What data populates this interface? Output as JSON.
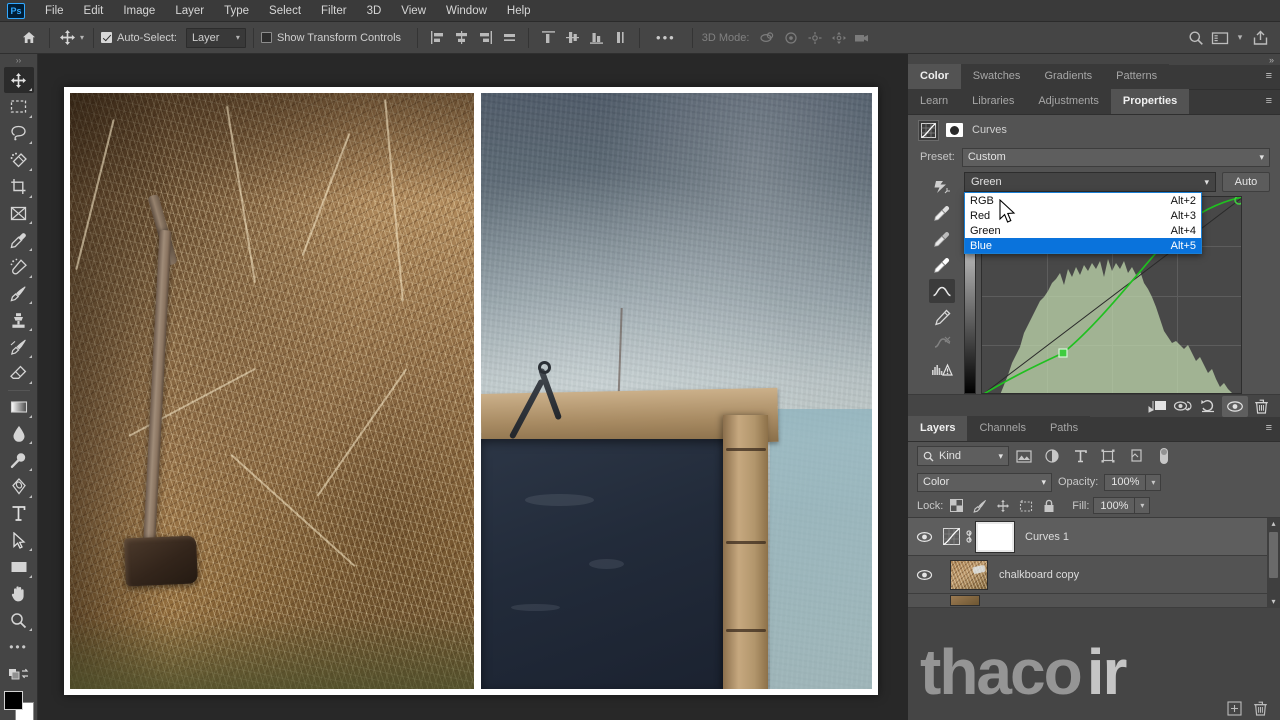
{
  "app": {
    "logo": "Ps",
    "menus": [
      "File",
      "Edit",
      "Image",
      "Layer",
      "Type",
      "Select",
      "Filter",
      "3D",
      "View",
      "Window",
      "Help"
    ]
  },
  "options_bar": {
    "home_icon": "home-icon",
    "tool_icon": "move-tool-icon",
    "auto_select_label": "Auto-Select:",
    "auto_select_checked": true,
    "auto_select_scope": "Layer",
    "show_transform_label": "Show Transform Controls",
    "show_transform_checked": false,
    "align_icons": [
      "align-left-edges-icon",
      "align-horizontal-centers-icon",
      "align-right-edges-icon",
      "distribute-horizontal-icon"
    ],
    "distribute_icons": [
      "align-top-edges-icon",
      "align-vertical-centers-icon",
      "align-bottom-edges-icon",
      "distribute-vertical-icon"
    ],
    "more_label": "•••",
    "three_d_label": "3D Mode:",
    "three_d_icons": [
      "orbit-3d-icon",
      "roll-3d-icon",
      "pan-3d-icon",
      "slide-3d-icon",
      "camera-3d-icon"
    ],
    "right_icons": [
      "search-icon",
      "workspace-icon",
      "chevron-down-icon",
      "share-icon"
    ]
  },
  "toolbar": {
    "tools": [
      {
        "name": "move-tool",
        "icon": "move-icon",
        "selected": true
      },
      {
        "name": "rectangular-marquee-tool",
        "icon": "marquee-icon",
        "selected": false
      },
      {
        "name": "lasso-tool",
        "icon": "lasso-icon",
        "selected": false
      },
      {
        "name": "quick-selection-tool",
        "icon": "quick-select-icon",
        "selected": false
      },
      {
        "name": "crop-tool",
        "icon": "crop-icon",
        "selected": false
      },
      {
        "name": "frame-tool",
        "icon": "frame-icon",
        "selected": false
      },
      {
        "name": "eyedropper-tool",
        "icon": "eyedropper-icon",
        "selected": false
      },
      {
        "name": "spot-healing-brush-tool",
        "icon": "healing-brush-icon",
        "selected": false
      },
      {
        "name": "brush-tool",
        "icon": "brush-icon",
        "selected": false
      },
      {
        "name": "clone-stamp-tool",
        "icon": "clone-stamp-icon",
        "selected": false
      },
      {
        "name": "history-brush-tool",
        "icon": "history-brush-icon",
        "selected": false
      },
      {
        "name": "eraser-tool",
        "icon": "eraser-icon",
        "selected": false
      },
      {
        "name": "gradient-tool",
        "icon": "gradient-icon",
        "selected": false
      },
      {
        "name": "blur-tool",
        "icon": "blur-drop-icon",
        "selected": false
      },
      {
        "name": "dodge-tool",
        "icon": "dodge-icon",
        "selected": false
      },
      {
        "name": "pen-tool",
        "icon": "pen-icon",
        "selected": false
      },
      {
        "name": "horizontal-type-tool",
        "icon": "type-icon",
        "selected": false
      },
      {
        "name": "path-selection-tool",
        "icon": "path-select-arrow-icon",
        "selected": false
      },
      {
        "name": "rectangle-tool",
        "icon": "rectangle-icon",
        "selected": false
      },
      {
        "name": "hand-tool",
        "icon": "hand-icon",
        "selected": false
      },
      {
        "name": "zoom-tool",
        "icon": "zoom-magnifier-icon",
        "selected": false
      },
      {
        "name": "edit-toolbar",
        "icon": "ellipsis-icon",
        "selected": false
      }
    ],
    "foreground_color": "#000000",
    "background_color": "#ffffff"
  },
  "canvas": {
    "left_photo_alt": "hay-bale-with-axe-photo",
    "right_photo_alt": "chalkboard-on-weathered-wall-photo"
  },
  "top_dock": {
    "tabs": [
      {
        "label": "Color",
        "active": true
      },
      {
        "label": "Swatches",
        "active": false
      },
      {
        "label": "Gradients",
        "active": false
      },
      {
        "label": "Patterns",
        "active": false
      }
    ],
    "menu_icon": "panel-menu-icon"
  },
  "properties_dock": {
    "tabs": [
      {
        "label": "Learn",
        "active": false
      },
      {
        "label": "Libraries",
        "active": false
      },
      {
        "label": "Adjustments",
        "active": false
      },
      {
        "label": "Properties",
        "active": true
      }
    ],
    "menu_icon": "panel-menu-icon"
  },
  "curves": {
    "title": "Curves",
    "adjustment_icon": "curves-adjustment-icon",
    "mask_icon": "layer-mask-icon",
    "preset_label": "Preset:",
    "preset_value": "Custom",
    "channel_value": "Green",
    "auto_label": "Auto",
    "channel_options": [
      {
        "label": "RGB",
        "shortcut": "Alt+2",
        "selected": false
      },
      {
        "label": "Red",
        "shortcut": "Alt+3",
        "selected": false
      },
      {
        "label": "Green",
        "shortcut": "Alt+4",
        "selected": false
      },
      {
        "label": "Blue",
        "shortcut": "Alt+5",
        "selected": true
      }
    ],
    "tools": [
      {
        "name": "on-image-adjustment-tool",
        "icon": "target-adjust-icon",
        "selected": false
      },
      {
        "name": "black-point-eyedropper",
        "icon": "eyedropper-black-icon",
        "selected": false
      },
      {
        "name": "gray-point-eyedropper",
        "icon": "eyedropper-gray-icon",
        "selected": false
      },
      {
        "name": "white-point-eyedropper",
        "icon": "eyedropper-white-icon",
        "selected": false
      },
      {
        "name": "curve-point-tool",
        "icon": "curve-point-icon",
        "selected": true
      },
      {
        "name": "pencil-draw-curve-tool",
        "icon": "pencil-icon",
        "selected": false
      },
      {
        "name": "smooth-curve-tool",
        "icon": "smooth-curve-icon",
        "selected": false
      },
      {
        "name": "histogram-options",
        "icon": "histogram-warning-icon",
        "selected": false
      }
    ],
    "bottom_icons": [
      {
        "name": "clip-to-layer-button",
        "icon": "clip-to-layer-icon",
        "highlighted": false
      },
      {
        "name": "toggle-previous-state-button",
        "icon": "eye-cycle-icon",
        "highlighted": false
      },
      {
        "name": "reset-adjustment-button",
        "icon": "reset-arrow-icon",
        "highlighted": false
      },
      {
        "name": "toggle-visibility-button",
        "icon": "eye-icon",
        "highlighted": true
      },
      {
        "name": "delete-adjustment-button",
        "icon": "trash-icon",
        "highlighted": false
      }
    ],
    "graph": {
      "curve_color": "#20c020",
      "histogram_color": "#c3ddb0",
      "control_points": [
        {
          "x": 0.0,
          "y": 0.0
        },
        {
          "x": 0.31,
          "y": 0.21
        },
        {
          "x": 0.73,
          "y": 0.86
        },
        {
          "x": 1.0,
          "y": 1.0
        }
      ],
      "grid_divisions": 4
    }
  },
  "layers_panel": {
    "tabs": [
      {
        "label": "Layers",
        "active": true
      },
      {
        "label": "Channels",
        "active": false
      },
      {
        "label": "Paths",
        "active": false
      }
    ],
    "menu_icon": "panel-menu-icon",
    "filter_label": "Kind",
    "filter_icon": "search-icon",
    "filter_type_icons": [
      "image-filter-icon",
      "adjustment-filter-icon",
      "type-filter-icon",
      "shape-filter-icon",
      "smart-object-filter-icon"
    ],
    "filter_toggle_icon": "filter-toggle-icon",
    "blend_mode": "Color",
    "opacity_label": "Opacity:",
    "opacity_value": "100%",
    "lock_label": "Lock:",
    "lock_icons": [
      "lock-transparent-pixels-icon",
      "lock-image-pixels-icon",
      "lock-position-icon",
      "lock-artboard-icon",
      "lock-all-icon"
    ],
    "fill_label": "Fill:",
    "fill_value": "100%",
    "layers": [
      {
        "name": "Curves 1",
        "visible": true,
        "active": true,
        "type": "adjustment",
        "linked": true
      },
      {
        "name": "chalkboard copy",
        "visible": true,
        "active": false,
        "type": "image",
        "linked": false
      }
    ],
    "bottom_icons": [
      {
        "name": "add-layer-button",
        "icon": "plus-square-icon"
      },
      {
        "name": "delete-layer-button",
        "icon": "trash-icon"
      }
    ]
  },
  "watermark": {
    "text": "thaco",
    "suffix": "ir"
  }
}
